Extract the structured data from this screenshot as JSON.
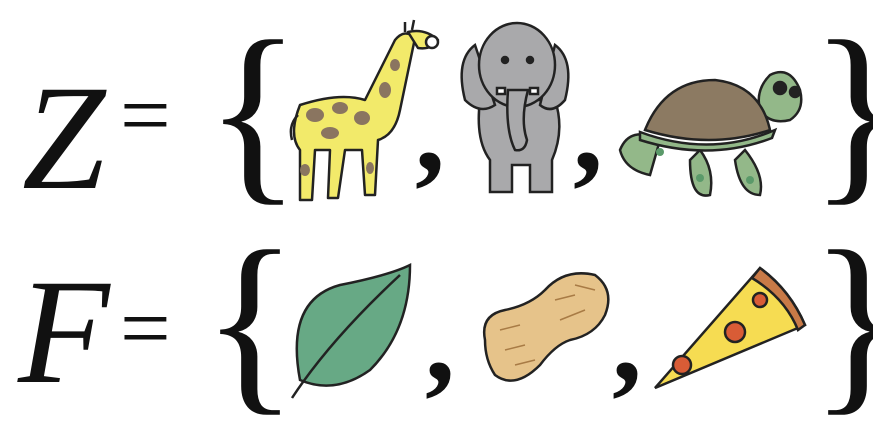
{
  "rows": [
    {
      "variable": "Z",
      "equals": "=",
      "open_brace": "{",
      "close_brace": "}",
      "separator": ",",
      "members": [
        "giraffe",
        "elephant",
        "turtle"
      ]
    },
    {
      "variable": "F",
      "equals": "=",
      "open_brace": "{",
      "close_brace": "}",
      "separator": ",",
      "members": [
        "leaf",
        "peanut",
        "pizza"
      ]
    }
  ],
  "colors": {
    "giraffe": "#f2ea6a",
    "giraffe_spots": "#8a7560",
    "elephant": "#a9a9ab",
    "turtle_shell": "#8c7a62",
    "turtle_skin": "#93b889",
    "leaf": "#67a985",
    "peanut": "#e6c38a",
    "pizza_cheese": "#f6dc52",
    "pizza_crust": "#c97a47",
    "pepperoni": "#d95c36"
  }
}
